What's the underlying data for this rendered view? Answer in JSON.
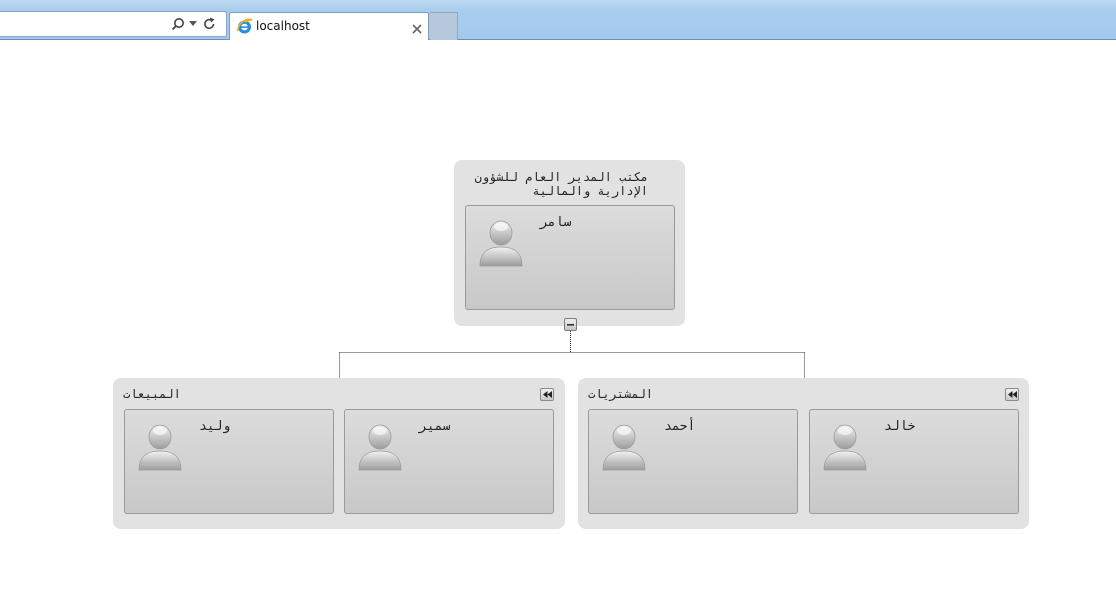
{
  "browser": {
    "tab_title": "localhost",
    "icons": [
      "search-icon",
      "dropdown-arrow-icon",
      "refresh-icon",
      "ie-logo-icon",
      "close-icon"
    ]
  },
  "colors": {
    "chrome_blue": "#a9cdee",
    "group_bg": "#e2e2e2",
    "card_bg": "#d2d2d2",
    "connector": "#333333"
  },
  "root": {
    "title": "مكتب المدير العام للشؤون\nالإدارية والمالية",
    "member": "سامر"
  },
  "departments": [
    {
      "title": "المبيعات",
      "members": [
        "وليد",
        "سمير"
      ]
    },
    {
      "title": "المشتريات",
      "members": [
        "أحمد",
        "خالد"
      ]
    }
  ]
}
